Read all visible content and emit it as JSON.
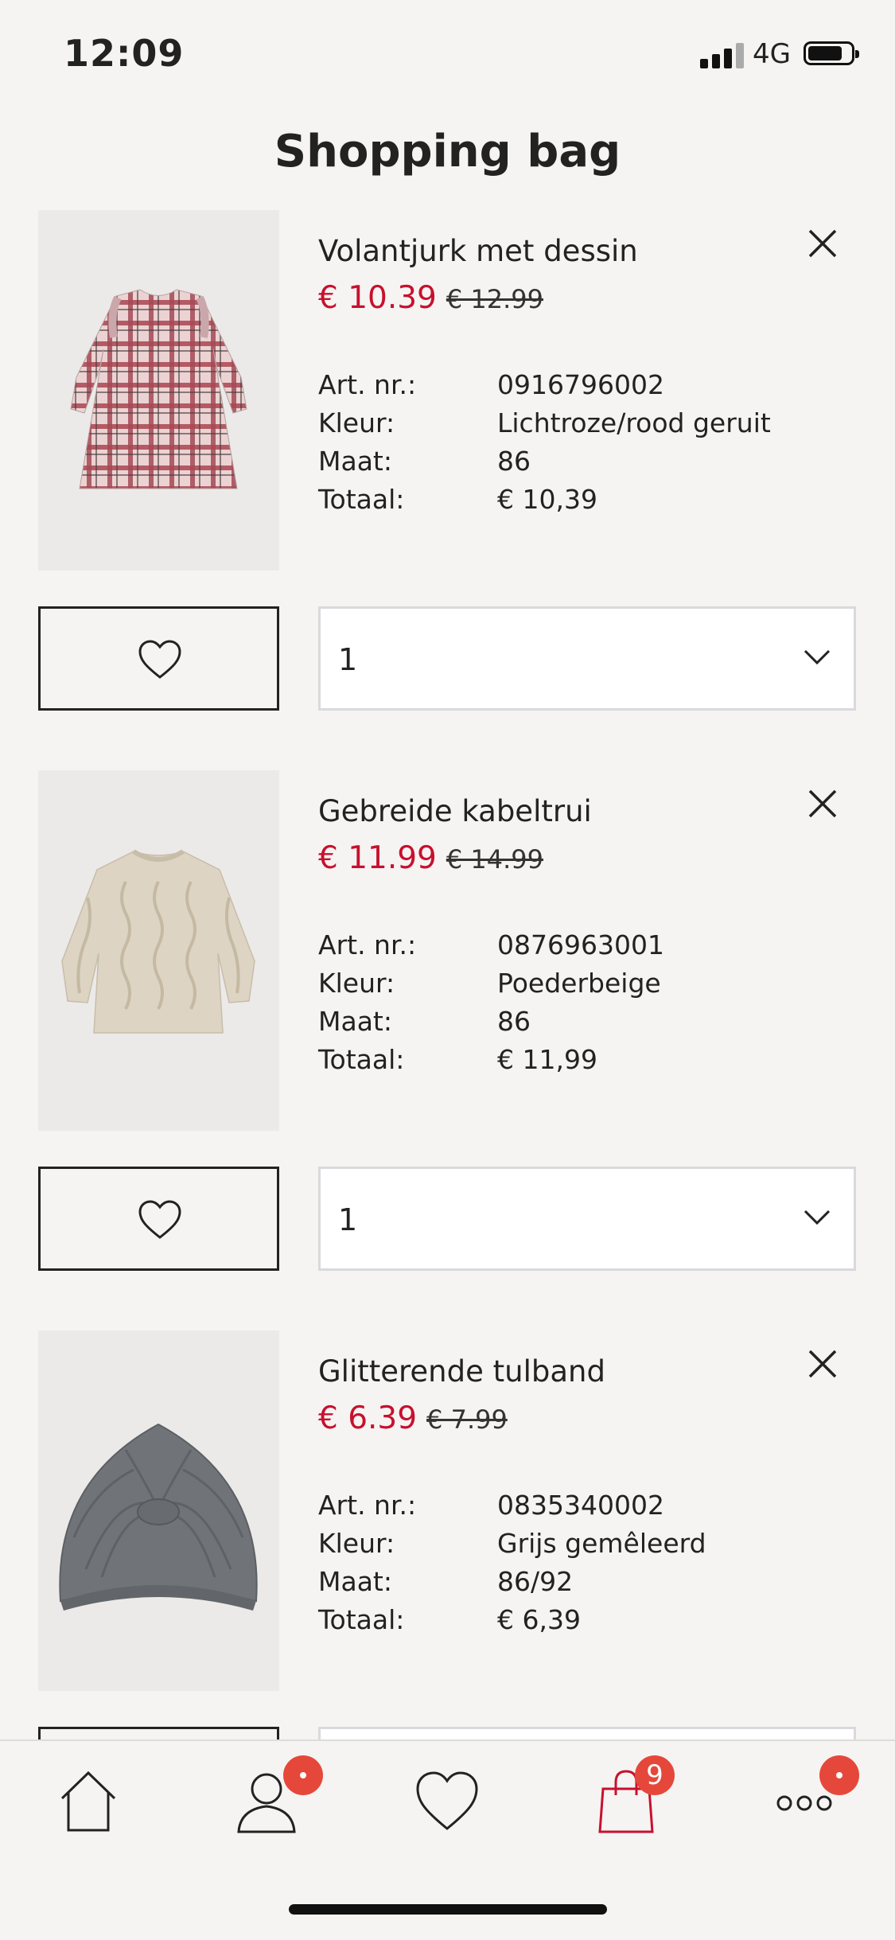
{
  "status_bar": {
    "time": "12:09",
    "network": "4G"
  },
  "page_title": "Shopping bag",
  "labels": {
    "art_nr": "Art. nr.:",
    "color": "Kleur:",
    "size": "Maat:",
    "total": "Totaal:"
  },
  "items": [
    {
      "name": "Volantjurk met dessin",
      "price": "€ 10.39",
      "old_price": "€ 12.99",
      "art_nr": "0916796002",
      "color": "Lichtroze/rood geruit",
      "size": "86",
      "total": "€ 10,39",
      "quantity": "1",
      "image_icon": "plaid-dress-image"
    },
    {
      "name": "Gebreide kabeltrui",
      "price": "€ 11.99",
      "old_price": "€ 14.99",
      "art_nr": "0876963001",
      "color": "Poederbeige",
      "size": "86",
      "total": "€ 11,99",
      "quantity": "1",
      "image_icon": "cable-knit-sweater-image"
    },
    {
      "name": "Glitterende tulband",
      "price": "€ 6.39",
      "old_price": "€ 7.99",
      "art_nr": "0835340002",
      "color": "Grijs gemêleerd",
      "size": "86/92",
      "total": "€ 6,39",
      "image_icon": "knit-turban-image"
    }
  ],
  "tab_bar": {
    "tabs": [
      {
        "icon": "home-icon"
      },
      {
        "icon": "account-icon",
        "badge": "dot"
      },
      {
        "icon": "favourites-icon"
      },
      {
        "icon": "shopping-bag-icon",
        "badge": "9"
      },
      {
        "icon": "more-icon",
        "badge": "dot"
      }
    ]
  },
  "colors": {
    "sale": "#c8102e",
    "badge": "#e5483b",
    "background": "#f5f4f2"
  }
}
